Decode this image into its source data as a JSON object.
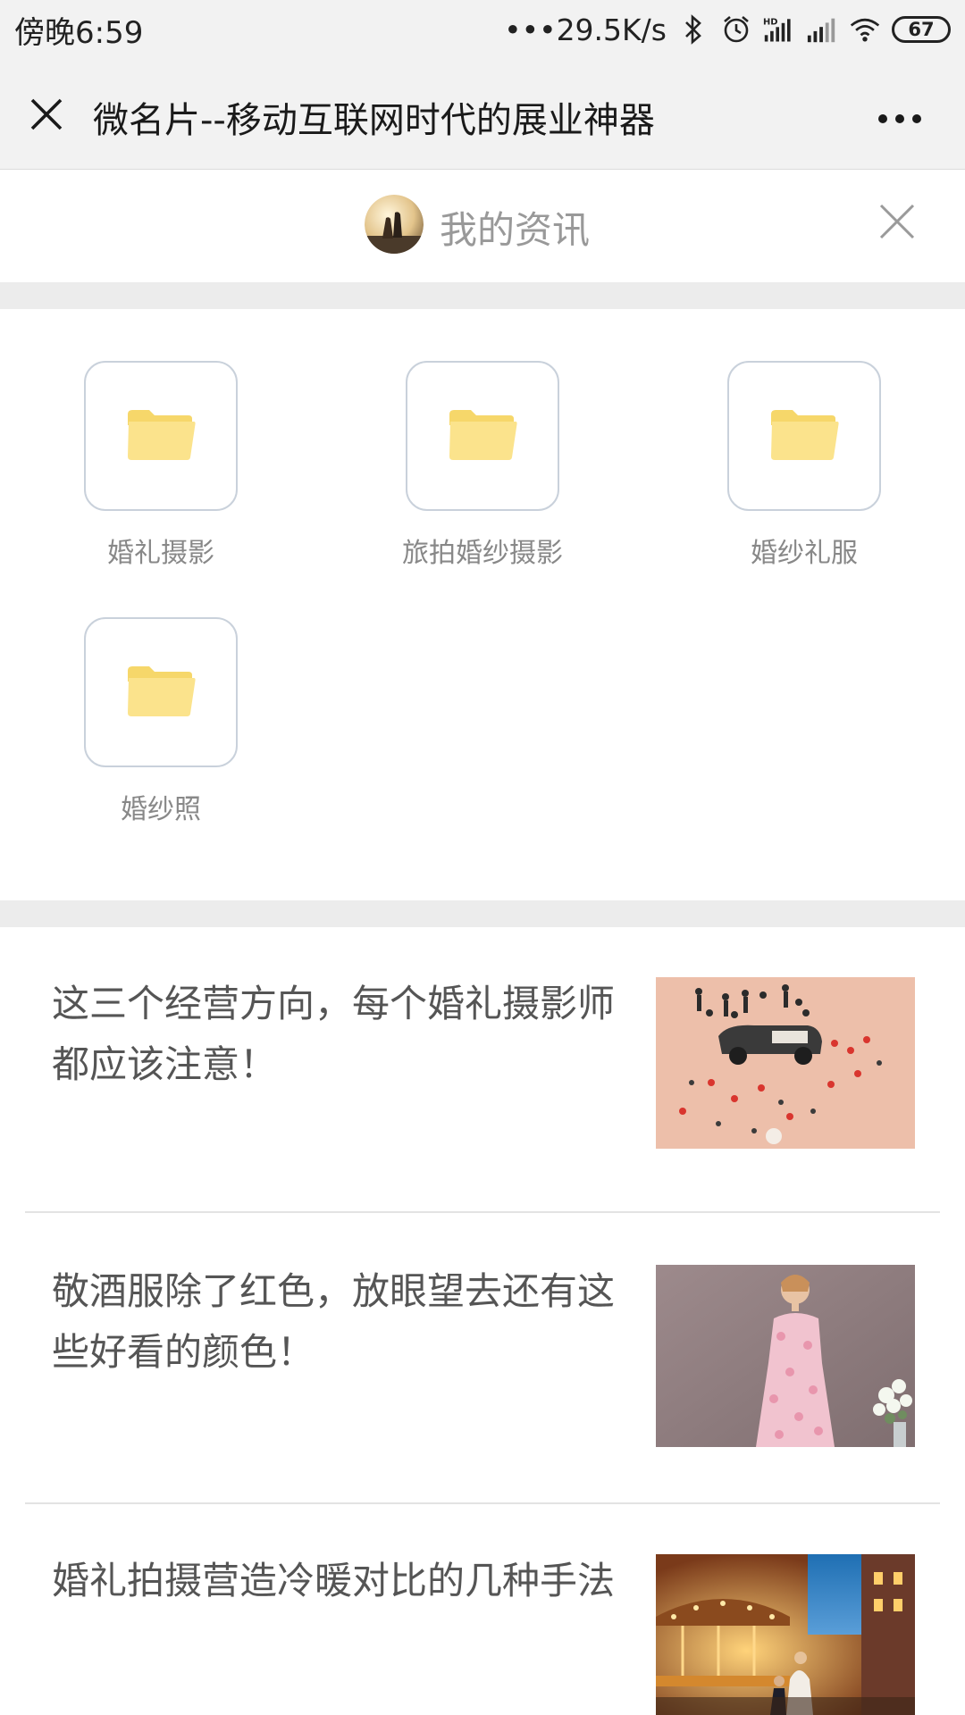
{
  "status_bar": {
    "time": "傍晚6:59",
    "net_speed": "•••29.5K/s",
    "battery": "67",
    "icons": [
      "bluetooth-icon",
      "alarm-icon",
      "hd-signal-icon",
      "signal-icon",
      "wifi-icon",
      "battery-icon"
    ]
  },
  "title_bar": {
    "title": "微名片--移动互联网时代的展业神器",
    "close_icon": "close-icon",
    "more_icon": "more-icon"
  },
  "sub_header": {
    "title": "我的资讯",
    "close_icon": "close-icon"
  },
  "categories": [
    {
      "label": "婚礼摄影",
      "icon": "folder-icon"
    },
    {
      "label": "旅拍婚纱摄影",
      "icon": "folder-icon"
    },
    {
      "label": "婚纱礼服",
      "icon": "folder-icon"
    },
    {
      "label": "婚纱照",
      "icon": "folder-icon"
    }
  ],
  "articles": [
    {
      "title": "这三个经营方向，每个婚礼摄影师都应该注意！"
    },
    {
      "title": "敬酒服除了红色，放眼望去还有这些好看的颜色！"
    },
    {
      "title": "婚礼拍摄营造冷暖对比的几种手法"
    }
  ],
  "colors": {
    "bar_bg": "#f2f2f2",
    "folder": "#fbe38c",
    "folder_back": "#f6d76a",
    "tile_border": "#c9d1db",
    "muted_text": "#888888"
  }
}
